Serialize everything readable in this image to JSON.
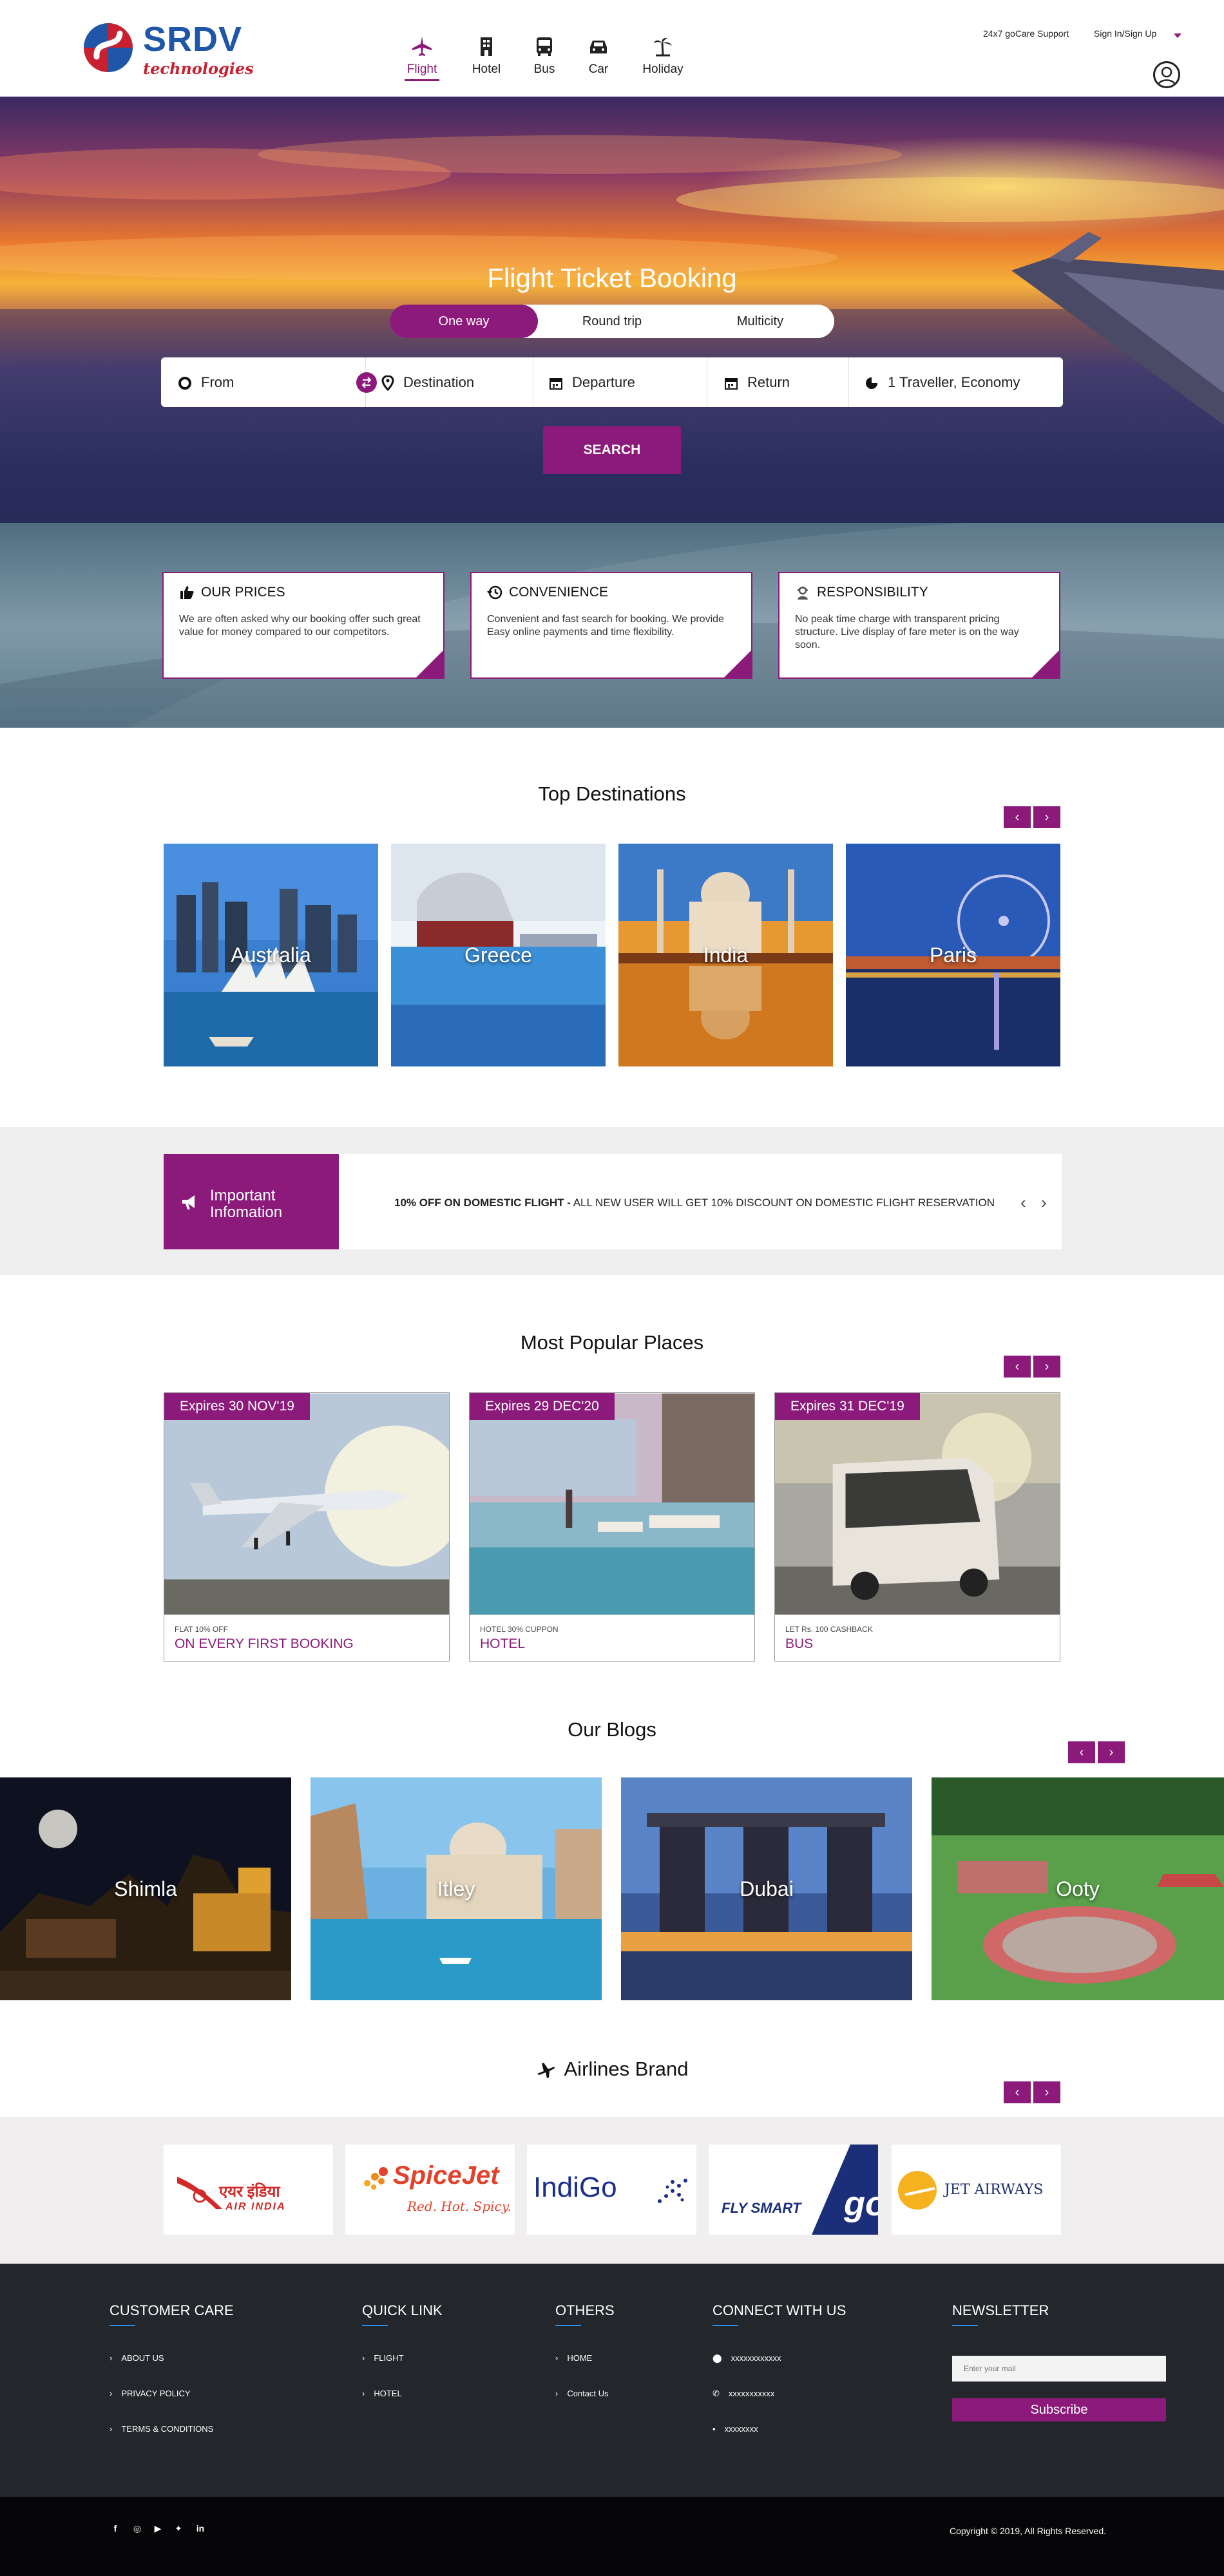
{
  "header": {
    "logo": {
      "name": "SRDV",
      "tagline": "technologies"
    },
    "nav": [
      {
        "label": "Flight",
        "icon": "plane-icon",
        "active": true
      },
      {
        "label": "Hotel",
        "icon": "hotel-icon"
      },
      {
        "label": "Bus",
        "icon": "bus-icon"
      },
      {
        "label": "Car",
        "icon": "car-icon"
      },
      {
        "label": "Holiday",
        "icon": "palm-tree-icon"
      }
    ],
    "support": "24x7 goCare Support",
    "signin": "Sign In/Sign Up"
  },
  "hero": {
    "title": "Flight Ticket Booking",
    "trip_types": [
      "One way",
      "Round trip",
      "Multicity"
    ],
    "fields": {
      "from": "From",
      "destination": "Destination",
      "departure": "Departure",
      "return": "Return",
      "travellers": "1 Traveller, Economy"
    },
    "search_label": "SEARCH"
  },
  "features": [
    {
      "title": "OUR PRICES",
      "icon": "thumbs-up-icon",
      "text": "We are often asked why our booking offer such great value for money compared to our competitors."
    },
    {
      "title": "CONVENIENCE",
      "icon": "history-icon",
      "text": "Convenient and fast search for booking. We provide Easy online payments and time flexibility."
    },
    {
      "title": "RESPONSIBILITY",
      "icon": "support-agent-icon",
      "text": "No peak time charge with transparent pricing structure. Live display of fare meter is on the way soon."
    }
  ],
  "top_destinations": {
    "title": "Top Destinations",
    "items": [
      "Australia",
      "Greece",
      "India",
      "Paris"
    ]
  },
  "info": {
    "badge": "Important Infomation",
    "highlight": "10% OFF ON DOMESTIC FLIGHT -",
    "text": "ALL NEW USER WILL GET 10% DISCOUNT ON DOMESTIC FLIGHT RESERVATION"
  },
  "popular": {
    "title": "Most Popular Places",
    "items": [
      {
        "badge": "Expires 30 NOV'19",
        "small": "FLAT 10% OFF",
        "big": "ON EVERY FIRST BOOKING"
      },
      {
        "badge": "Expires 29 DEC'20",
        "small": "HOTEL 30% CUPPON",
        "big": "HOTEL"
      },
      {
        "badge": "Expires 31 DEC'19",
        "small": "LET Rs. 100 CASHBACK",
        "big": "BUS"
      }
    ]
  },
  "blogs": {
    "title": "Our Blogs",
    "items": [
      "Shimla",
      "Itley",
      "Dubai",
      "Ooty"
    ]
  },
  "airlines": {
    "title": "Airlines Brand",
    "items": [
      {
        "name": "AIR INDIA",
        "script": "एयर इंडिया"
      },
      {
        "name": "SpiceJet",
        "tag": "Red. Hot. Spicy."
      },
      {
        "name": "IndiGo"
      },
      {
        "name": "FLY SMART",
        "mark": "go"
      },
      {
        "name": "JET AIRWAYS"
      }
    ]
  },
  "footer": {
    "customer_care": {
      "title": "CUSTOMER CARE",
      "links": [
        "ABOUT US",
        "PRIVACY POLICY",
        "TERMS & CONDITIONS"
      ]
    },
    "quick_link": {
      "title": "QUICK LINK",
      "links": [
        "FLIGHT",
        "HOTEL"
      ]
    },
    "others": {
      "title": "OTHERS",
      "links": [
        "HOME",
        "Contact Us"
      ]
    },
    "connect": {
      "title": "CONNECT WITH US",
      "items": [
        "xxxxxxxxxxxx",
        "xxxxxxxxxxx",
        "xxxxxxxx"
      ]
    },
    "newsletter": {
      "title": "NEWSLETTER",
      "placeholder": "Enter your mail",
      "button": "Subscribe"
    },
    "social": [
      "facebook-icon",
      "instagram-icon",
      "youtube-icon",
      "twitter-icon",
      "linkedin-icon"
    ],
    "copyright": "Copyright © 2019, All Rights Reserved."
  },
  "colors": {
    "brand": "#8b1a7a",
    "footer": "#23262b",
    "logo_blue": "#1f56a8",
    "logo_red": "#c8202f"
  }
}
